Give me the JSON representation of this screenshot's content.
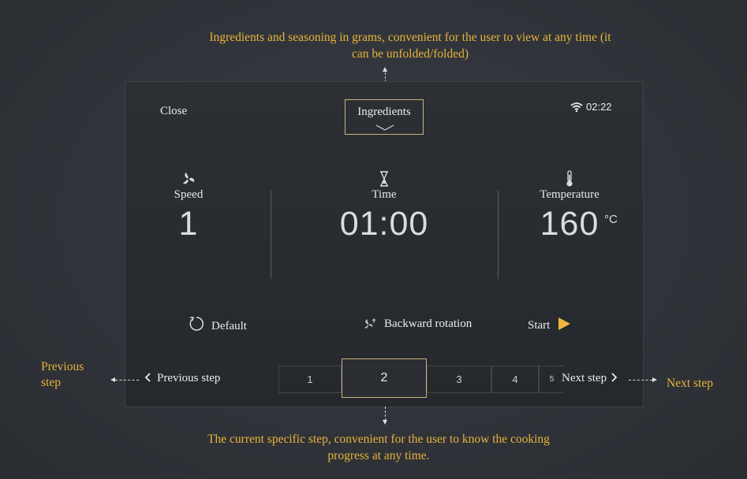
{
  "annotations": {
    "ingredients_note_line1": "Ingredients and seasoning in grams, convenient for the user to view at any time (it",
    "ingredients_note_line2": "can be unfolded/folded)",
    "current_step_note_line1": "The current specific step, convenient for the user to know the cooking",
    "current_step_note_line2": "progress at any time.",
    "previous_step_note_line1": "Previous",
    "previous_step_note_line2": "step",
    "next_step_note": "Next step"
  },
  "header": {
    "close_label": "Close",
    "ingredients_label": "Ingredients",
    "clock": "02:22",
    "wifi_icon": "wifi-icon"
  },
  "metrics": {
    "speed": {
      "label": "Speed",
      "value": "1",
      "icon": "fan-icon"
    },
    "time": {
      "label": "Time",
      "value": "01:00",
      "icon": "hourglass-icon"
    },
    "temperature": {
      "label": "Temperature",
      "value": "160",
      "unit": "°C",
      "icon": "thermometer-icon"
    }
  },
  "actions": {
    "default_label": "Default",
    "backward_label": "Backward rotation",
    "start_label": "Start"
  },
  "navigation": {
    "previous_label": "Previous step",
    "next_label": "Next step",
    "steps": [
      "1",
      "2",
      "3",
      "4",
      "5"
    ],
    "current_step": "2"
  },
  "colors": {
    "accent": "#e8b33a",
    "highlight_border": "#c9b27c",
    "panel": "#2a2d31",
    "background": "#30343a"
  }
}
